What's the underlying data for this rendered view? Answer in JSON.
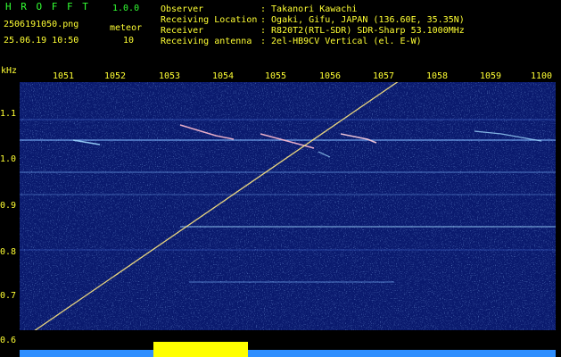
{
  "header": {
    "app_name": "H R O F F T",
    "version": "1.0.0",
    "filename": "2506191050.png",
    "meteor_label": "meteor",
    "timestamp": "25.06.19 10:50",
    "meteor_count": "10"
  },
  "station": {
    "observer_label": "Observer",
    "observer_value": ": Takanori Kawachi",
    "location_label": "Receiving Location",
    "location_value": ": Ogaki, Gifu, JAPAN (136.60E, 35.35N)",
    "receiver_label": "Receiver",
    "receiver_value": ": R820T2(RTL-SDR) SDR-Sharp 53.1000MHz",
    "antenna_label": "Receiving antenna",
    "antenna_value": ": 2el-HB9CV Vertical (el. E-W)"
  },
  "axes": {
    "y_unit": "kHz",
    "x_ticks": [
      "1051",
      "1052",
      "1053",
      "1054",
      "1055",
      "1056",
      "1057",
      "1058",
      "1059",
      "1100"
    ],
    "y_ticks": [
      "1.1",
      "1.0",
      "0.9",
      "0.8",
      "0.7",
      "0.6"
    ]
  },
  "colors": {
    "header_text": "#ffff33",
    "accent_text": "#33ff33",
    "background": "#000000",
    "spectrogram_bg": "#0a1a6e",
    "signal": "#9fd8ff",
    "meteor_bar": "#ffff00",
    "noise_bar": "#33a0ff"
  }
}
